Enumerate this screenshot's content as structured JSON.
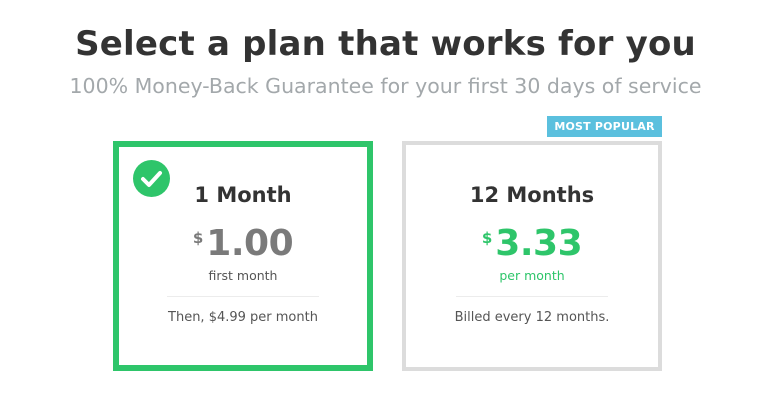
{
  "header": {
    "title": "Select a plan that works for you",
    "subtitle": "100% Money-Back Guarantee for your first 30 days of service"
  },
  "plans": [
    {
      "name": "1 Month",
      "currency": "$",
      "price": "1.00",
      "price_note": "first month",
      "billing": "Then, $4.99 per month",
      "selected": true,
      "selected_icon": "checkmark-icon"
    },
    {
      "name": "12 Months",
      "currency": "$",
      "price": "3.33",
      "price_note": "per month",
      "billing": "Billed every 12 months.",
      "badge": "MOST POPULAR",
      "selected": false
    }
  ],
  "colors": {
    "accent_green": "#2ec56a",
    "badge_blue": "#5bc0de",
    "title_text": "#333333",
    "subtitle_text": "#a3a8ab",
    "unselected_border": "#dcdcdc"
  }
}
